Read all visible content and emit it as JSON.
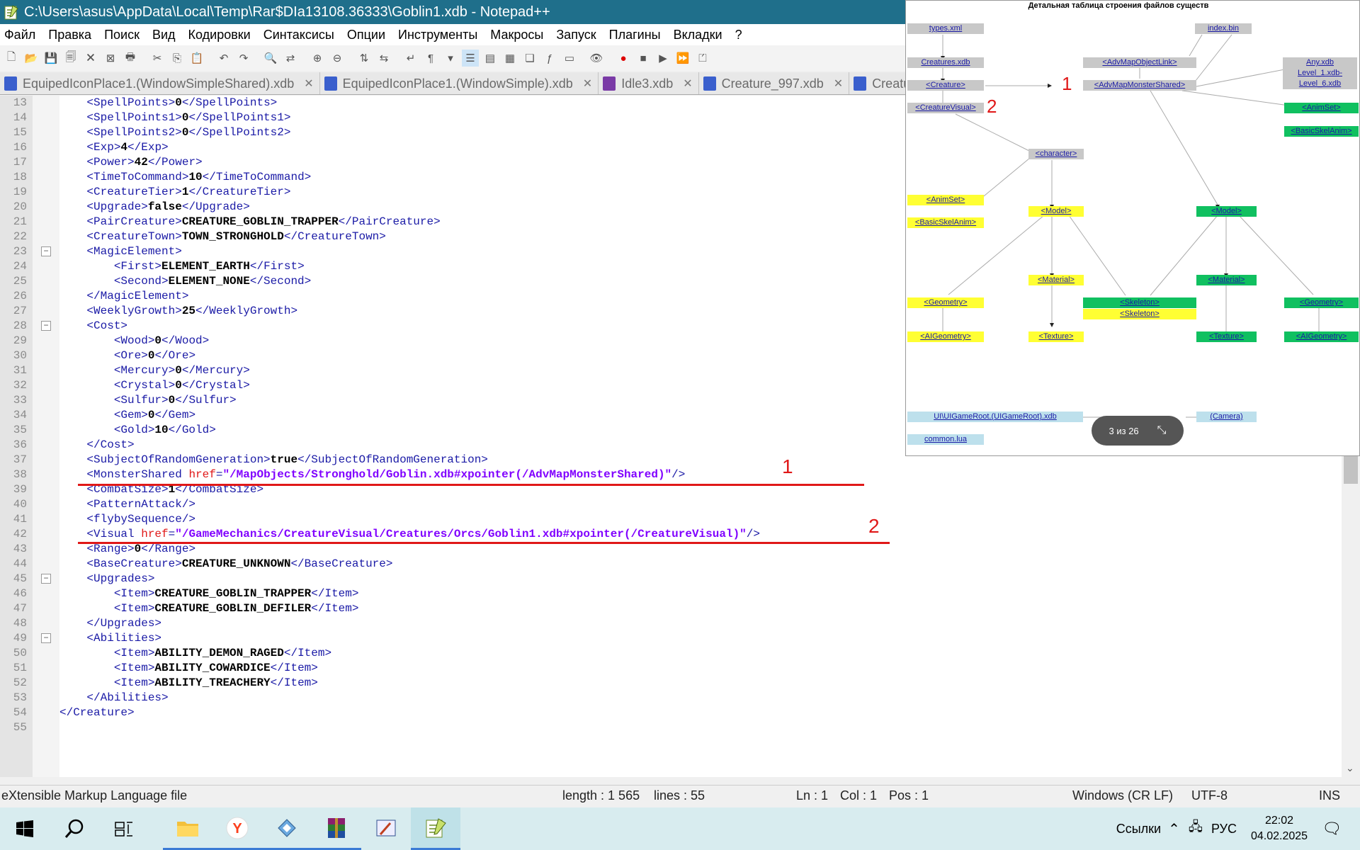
{
  "window": {
    "title": "C:\\Users\\asus\\AppData\\Local\\Temp\\Rar$DIa13108.36333\\Goblin1.xdb - Notepad++"
  },
  "menu": [
    "Файл",
    "Правка",
    "Поиск",
    "Вид",
    "Кодировки",
    "Синтаксисы",
    "Опции",
    "Инструменты",
    "Макросы",
    "Запуск",
    "Плагины",
    "Вкладки",
    "?"
  ],
  "tabs": [
    {
      "label": "EquipedIconPlace1.(WindowSimpleShared).xdb"
    },
    {
      "label": "EquipedIconPlace1.(WindowSimple).xdb"
    },
    {
      "label": "Idle3.xdb"
    },
    {
      "label": "Creature_997.xdb"
    },
    {
      "label": "Creature"
    }
  ],
  "editor": {
    "lines": [
      {
        "n": "13",
        "indent": "    ",
        "open": "<SpellPoints>",
        "value": "0",
        "close": "</SpellPoints>"
      },
      {
        "n": "14",
        "indent": "    ",
        "open": "<SpellPoints1>",
        "value": "0",
        "close": "</SpellPoints1>"
      },
      {
        "n": "15",
        "indent": "    ",
        "open": "<SpellPoints2>",
        "value": "0",
        "close": "</SpellPoints2>"
      },
      {
        "n": "16",
        "indent": "    ",
        "open": "<Exp>",
        "value": "4",
        "close": "</Exp>"
      },
      {
        "n": "17",
        "indent": "    ",
        "open": "<Power>",
        "value": "42",
        "close": "</Power>"
      },
      {
        "n": "18",
        "indent": "    ",
        "open": "<TimeToCommand>",
        "value": "10",
        "close": "</TimeToCommand>"
      },
      {
        "n": "19",
        "indent": "    ",
        "open": "<CreatureTier>",
        "value": "1",
        "close": "</CreatureTier>"
      },
      {
        "n": "20",
        "indent": "    ",
        "open": "<Upgrade>",
        "value": "false",
        "close": "</Upgrade>"
      },
      {
        "n": "21",
        "indent": "    ",
        "open": "<PairCreature>",
        "value": "CREATURE_GOBLIN_TRAPPER",
        "close": "</PairCreature>"
      },
      {
        "n": "22",
        "indent": "    ",
        "open": "<CreatureTown>",
        "value": "TOWN_STRONGHOLD",
        "close": "</CreatureTown>"
      },
      {
        "n": "23",
        "indent": "    ",
        "open": "<MagicElement>",
        "value": "",
        "close": ""
      },
      {
        "n": "24",
        "indent": "        ",
        "open": "<First>",
        "value": "ELEMENT_EARTH",
        "close": "</First>"
      },
      {
        "n": "25",
        "indent": "        ",
        "open": "<Second>",
        "value": "ELEMENT_NONE",
        "close": "</Second>"
      },
      {
        "n": "26",
        "indent": "    ",
        "open": "</MagicElement>",
        "value": "",
        "close": ""
      },
      {
        "n": "27",
        "indent": "    ",
        "open": "<WeeklyGrowth>",
        "value": "25",
        "close": "</WeeklyGrowth>"
      },
      {
        "n": "28",
        "indent": "    ",
        "open": "<Cost>",
        "value": "",
        "close": ""
      },
      {
        "n": "29",
        "indent": "        ",
        "open": "<Wood>",
        "value": "0",
        "close": "</Wood>"
      },
      {
        "n": "30",
        "indent": "        ",
        "open": "<Ore>",
        "value": "0",
        "close": "</Ore>"
      },
      {
        "n": "31",
        "indent": "        ",
        "open": "<Mercury>",
        "value": "0",
        "close": "</Mercury>"
      },
      {
        "n": "32",
        "indent": "        ",
        "open": "<Crystal>",
        "value": "0",
        "close": "</Crystal>"
      },
      {
        "n": "33",
        "indent": "        ",
        "open": "<Sulfur>",
        "value": "0",
        "close": "</Sulfur>"
      },
      {
        "n": "34",
        "indent": "        ",
        "open": "<Gem>",
        "value": "0",
        "close": "</Gem>"
      },
      {
        "n": "35",
        "indent": "        ",
        "open": "<Gold>",
        "value": "10",
        "close": "</Gold>"
      },
      {
        "n": "36",
        "indent": "    ",
        "open": "</Cost>",
        "value": "",
        "close": ""
      },
      {
        "n": "37",
        "indent": "    ",
        "open": "<SubjectOfRandomGeneration>",
        "value": "true",
        "close": "</SubjectOfRandomGeneration>"
      },
      {
        "n": "38",
        "indent": "    ",
        "open": "<MonsterShared ",
        "attr": "href",
        "aval": "\"/MapObjects/Stronghold/Goblin.xdb#xpointer(/AdvMapMonsterShared)\"",
        "close": "/>"
      },
      {
        "n": "39",
        "indent": "    ",
        "open": "<CombatSize>",
        "value": "1",
        "close": "</CombatSize>"
      },
      {
        "n": "40",
        "indent": "    ",
        "open": "<PatternAttack/>",
        "value": "",
        "close": ""
      },
      {
        "n": "41",
        "indent": "    ",
        "open": "<flybySequence/>",
        "value": "",
        "close": ""
      },
      {
        "n": "42",
        "indent": "    ",
        "open": "<Visual ",
        "attr": "href",
        "aval": "\"/GameMechanics/CreatureVisual/Creatures/Orcs/Goblin1.xdb#xpointer(/CreatureVisual)\"",
        "close": "/>"
      },
      {
        "n": "43",
        "indent": "    ",
        "open": "<Range>",
        "value": "0",
        "close": "</Range>"
      },
      {
        "n": "44",
        "indent": "    ",
        "open": "<BaseCreature>",
        "value": "CREATURE_UNKNOWN",
        "close": "</BaseCreature>"
      },
      {
        "n": "45",
        "indent": "    ",
        "open": "<Upgrades>",
        "value": "",
        "close": ""
      },
      {
        "n": "46",
        "indent": "        ",
        "open": "<Item>",
        "value": "CREATURE_GOBLIN_TRAPPER",
        "close": "</Item>"
      },
      {
        "n": "47",
        "indent": "        ",
        "open": "<Item>",
        "value": "CREATURE_GOBLIN_DEFILER",
        "close": "</Item>"
      },
      {
        "n": "48",
        "indent": "    ",
        "open": "</Upgrades>",
        "value": "",
        "close": ""
      },
      {
        "n": "49",
        "indent": "    ",
        "open": "<Abilities>",
        "value": "",
        "close": ""
      },
      {
        "n": "50",
        "indent": "        ",
        "open": "<Item>",
        "value": "ABILITY_DEMON_RAGED",
        "close": "</Item>"
      },
      {
        "n": "51",
        "indent": "        ",
        "open": "<Item>",
        "value": "ABILITY_COWARDICE",
        "close": "</Item>"
      },
      {
        "n": "52",
        "indent": "        ",
        "open": "<Item>",
        "value": "ABILITY_TREACHERY",
        "close": "</Item>"
      },
      {
        "n": "53",
        "indent": "    ",
        "open": "</Abilities>",
        "value": "",
        "close": ""
      },
      {
        "n": "54",
        "indent": "",
        "open": "</Creature>",
        "value": "",
        "close": ""
      },
      {
        "n": "55",
        "indent": "",
        "open": "",
        "value": "",
        "close": ""
      }
    ],
    "annotation_1": "1",
    "annotation_2": "2"
  },
  "status": {
    "filetype": "eXtensible Markup Language file",
    "length": "length : 1 565",
    "lines": "lines : 55",
    "ln": "Ln : 1",
    "col": "Col : 1",
    "pos": "Pos : 1",
    "eol": "Windows (CR LF)",
    "encoding": "UTF-8",
    "mode": "INS"
  },
  "diagram": {
    "title": "Детальная таблица строения файлов существ",
    "pager": "3 из 26",
    "annotation_1": "1",
    "annotation_2": "2",
    "nodes": {
      "types": "types.xml",
      "index": "index.bin",
      "creatures_xdb": "Creatures.xdb",
      "advmapobjectlink": "<AdvMapObjectLink>",
      "any_xdb": "Any.xdb",
      "level1": "Level_1.xdb-",
      "level6": "Level_6.xdb",
      "creature": "<Creature>",
      "advmapmonstershared": "<AdvMapMonsterShared>",
      "creaturevisual": "<CreatureVisual>",
      "animset_r": "<AnimSet>",
      "basicskelanim_r": "<BasicSkelAnim>",
      "character": "<character>",
      "animset_l": "<AnimSet>",
      "basicskelanim_l": "<BasicSkelAnim>",
      "model_y": "<Model>",
      "model_g": "<Model>",
      "material_y": "<Material>",
      "material_g": "<Material>",
      "geometry_l": "<Geometry>",
      "skeleton_g": "<Skeleton>",
      "skeleton_y": "<Skeleton>",
      "geometry_r": "<Geometry>",
      "aigeometry_l": "<AIGeometry>",
      "texture_y": "<Texture>",
      "texture_g": "<Texture>",
      "aigeometry_r": "<AIGeometry>",
      "uigameroot": "UI\\UIGameRoot.(UIGameRoot).xdb",
      "camera": "(Camera)",
      "common_lua": "common.lua"
    }
  },
  "taskbar": {
    "links": "Ссылки",
    "lang": "РУС",
    "time": "22:02",
    "date": "04.02.2025"
  }
}
